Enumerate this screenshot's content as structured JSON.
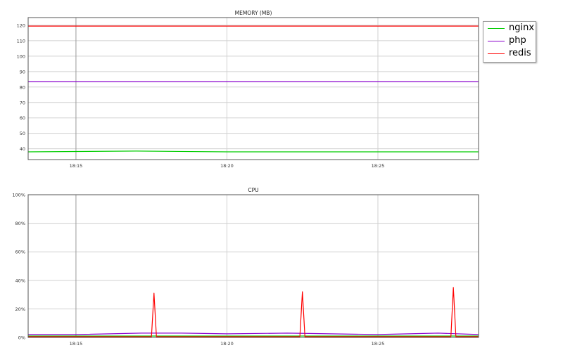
{
  "chart_data": [
    {
      "type": "line",
      "title": "MEMORY (MB)",
      "xlabel": "",
      "ylabel": "",
      "x_range": [
        "18:13:25",
        "18:28:20"
      ],
      "x_ticks": [
        "18:15",
        "18:20",
        "18:25"
      ],
      "ylim": [
        33,
        125
      ],
      "y_ticks": [
        "40",
        "50",
        "60",
        "70",
        "80",
        "90",
        "100",
        "110",
        "120"
      ],
      "grid": true,
      "series": [
        {
          "name": "nginx",
          "color": "#00cc00",
          "x": [
            "18:13:25",
            "18:17:00",
            "18:20:00",
            "18:25:00",
            "18:28:20"
          ],
          "y": [
            38,
            38.5,
            38,
            38,
            38
          ]
        },
        {
          "name": "php",
          "color": "#8800cc",
          "x": [
            "18:13:25",
            "18:20:00",
            "18:28:20"
          ],
          "y": [
            83.5,
            83.5,
            83.5
          ]
        },
        {
          "name": "redis",
          "color": "#ff0000",
          "x": [
            "18:13:25",
            "18:20:00",
            "18:28:20"
          ],
          "y": [
            119.5,
            119.5,
            119.5
          ]
        }
      ]
    },
    {
      "type": "line",
      "title": "CPU",
      "xlabel": "",
      "ylabel": "",
      "x_range": [
        "18:13:25",
        "18:28:20"
      ],
      "x_ticks": [
        "18:15",
        "18:20",
        "18:25"
      ],
      "ylim": [
        0,
        100
      ],
      "y_ticks": [
        "0%",
        "20%",
        "40%",
        "60%",
        "80%",
        "100%"
      ],
      "grid": true,
      "series": [
        {
          "name": "nginx",
          "color": "#00cc00",
          "x": [
            "18:13:25",
            "18:28:20"
          ],
          "y": [
            1,
            1
          ]
        },
        {
          "name": "php",
          "color": "#8800cc",
          "x": [
            "18:13:25",
            "18:15:00",
            "18:17:10",
            "18:18:30",
            "18:20:00",
            "18:22:00",
            "18:25:00",
            "18:27:00",
            "18:28:20"
          ],
          "y": [
            2,
            2,
            3,
            3,
            2.5,
            3,
            2,
            3,
            2
          ]
        },
        {
          "name": "redis",
          "color": "#ff0000",
          "x": [
            "18:13:25",
            "18:17:30",
            "18:17:35",
            "18:17:40",
            "18:22:25",
            "18:22:30",
            "18:22:35",
            "18:27:25",
            "18:27:30",
            "18:27:35",
            "18:28:20"
          ],
          "y": [
            0.5,
            0.5,
            31,
            0.5,
            0.5,
            32,
            0.5,
            0.5,
            35,
            0.5,
            0.5
          ]
        }
      ]
    }
  ],
  "legend": {
    "placement": "top-right",
    "items": [
      {
        "label": "nginx",
        "color": "#00cc00"
      },
      {
        "label": "php",
        "color": "#8800cc"
      },
      {
        "label": "redis",
        "color": "#ff0000"
      }
    ]
  }
}
